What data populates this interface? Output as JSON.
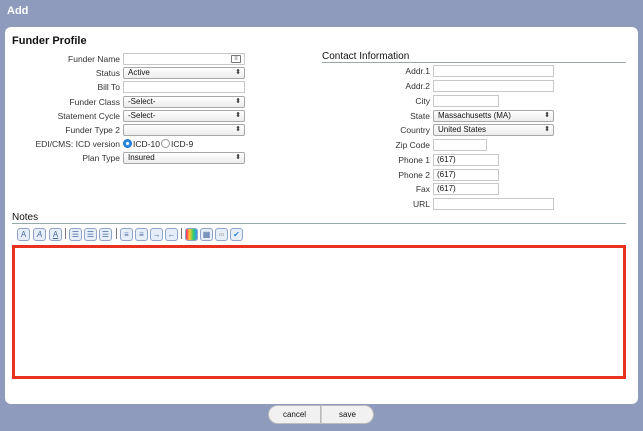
{
  "window": {
    "title": "Add"
  },
  "funder_profile": {
    "title": "Funder Profile",
    "funder_name": {
      "label": "Funder Name",
      "value": ""
    },
    "status": {
      "label": "Status",
      "value": "Active"
    },
    "bill_to": {
      "label": "Bill To",
      "value": ""
    },
    "funder_class": {
      "label": "Funder Class",
      "value": "-Select-"
    },
    "statement_cycle": {
      "label": "Statement Cycle",
      "value": "-Select-"
    },
    "funder_type_2": {
      "label": "Funder Type 2",
      "value": ""
    },
    "icd_version": {
      "label": "EDI/CMS: ICD version",
      "options": [
        "ICD-10",
        "ICD-9"
      ],
      "selected": "ICD-10"
    },
    "plan_type": {
      "label": "Plan Type",
      "value": "Insured"
    }
  },
  "contact": {
    "title": "Contact Information",
    "addr1": {
      "label": "Addr.1",
      "value": ""
    },
    "addr2": {
      "label": "Addr.2",
      "value": ""
    },
    "city": {
      "label": "City",
      "value": ""
    },
    "state": {
      "label": "State",
      "value": "Massachusetts (MA)"
    },
    "country": {
      "label": "Country",
      "value": "United States"
    },
    "zip": {
      "label": "Zip Code",
      "value": ""
    },
    "phone1": {
      "label": "Phone 1",
      "value": "(617)"
    },
    "phone2": {
      "label": "Phone 2",
      "value": "(617)"
    },
    "fax": {
      "label": "Fax",
      "value": "(617)"
    },
    "url": {
      "label": "URL",
      "value": ""
    }
  },
  "notes": {
    "title": "Notes",
    "content": ""
  },
  "toolbar": {
    "icons": [
      "font-bold-icon",
      "font-italic-icon",
      "font-underline-icon",
      "align-left-icon",
      "align-center-icon",
      "align-right-icon",
      "bullet-list-icon",
      "numbered-list-icon",
      "indent-icon",
      "outdent-icon",
      "color-picker-icon",
      "table-icon",
      "link-icon",
      "spellcheck-icon"
    ]
  },
  "buttons": {
    "cancel": "cancel",
    "save": "save"
  },
  "colors": {
    "chrome": "#8e9bbd",
    "editor_border": "#e8311f",
    "radio_on": "#2e8be6"
  }
}
